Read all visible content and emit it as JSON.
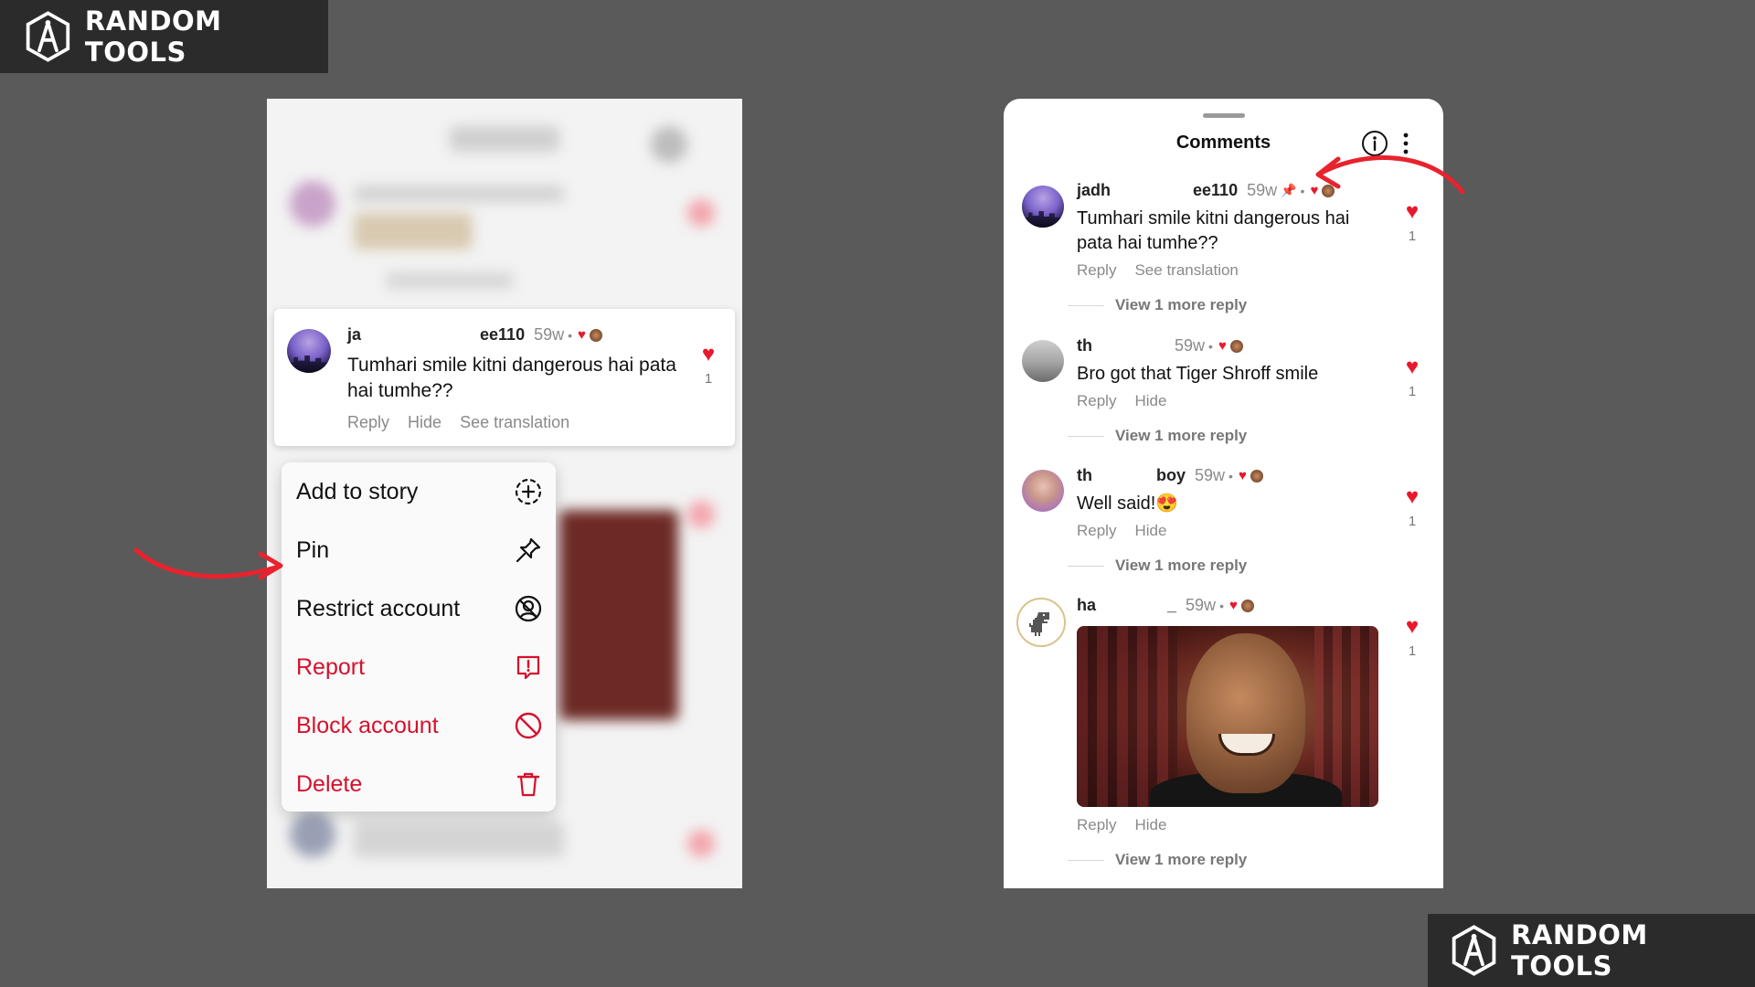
{
  "brand": {
    "name": "RANDOM TOOLS"
  },
  "colors": {
    "background": "#5a5a5a",
    "accent_red": "#e8192c",
    "danger": "#d5112c"
  },
  "left_panel": {
    "comment": {
      "username_start": "ja",
      "username_end": "ee110",
      "time": "59w",
      "text": "Tumhari smile kitni dangerous hai pata hai tumhe??",
      "actions": [
        "Reply",
        "Hide",
        "See translation"
      ],
      "likes": "1"
    },
    "menu": [
      {
        "label": "Add to story",
        "icon": "add-circle-icon",
        "danger": false
      },
      {
        "label": "Pin",
        "icon": "pin-icon",
        "danger": false
      },
      {
        "label": "Restrict account",
        "icon": "restrict-icon",
        "danger": false
      },
      {
        "label": "Report",
        "icon": "report-icon",
        "danger": true
      },
      {
        "label": "Block account",
        "icon": "block-icon",
        "danger": true
      },
      {
        "label": "Delete",
        "icon": "trash-icon",
        "danger": true
      }
    ]
  },
  "right_panel": {
    "title": "Comments",
    "comments": [
      {
        "username_start": "jadh",
        "username_end": "ee110",
        "time": "59w",
        "text": "Tumhari smile kitni dangerous hai pata hai tumhe??",
        "actions": [
          "Reply",
          "See translation"
        ],
        "likes": "1",
        "view_more": "View 1 more reply"
      },
      {
        "username_start": "th",
        "username_end": "",
        "time": "59w",
        "text": "Bro got that Tiger Shroff smile",
        "actions": [
          "Reply",
          "Hide"
        ],
        "likes": "1",
        "view_more": "View 1 more reply"
      },
      {
        "username_start": "th",
        "username_end": "boy",
        "time": "59w",
        "text": "Well said!😍",
        "actions": [
          "Reply",
          "Hide"
        ],
        "likes": "1",
        "view_more": "View 1 more reply"
      },
      {
        "username_start": "ha",
        "username_end": "_",
        "time": "59w",
        "text": "",
        "actions": [
          "Reply",
          "Hide"
        ],
        "likes": "1",
        "view_more": "View 1 more reply"
      }
    ]
  }
}
